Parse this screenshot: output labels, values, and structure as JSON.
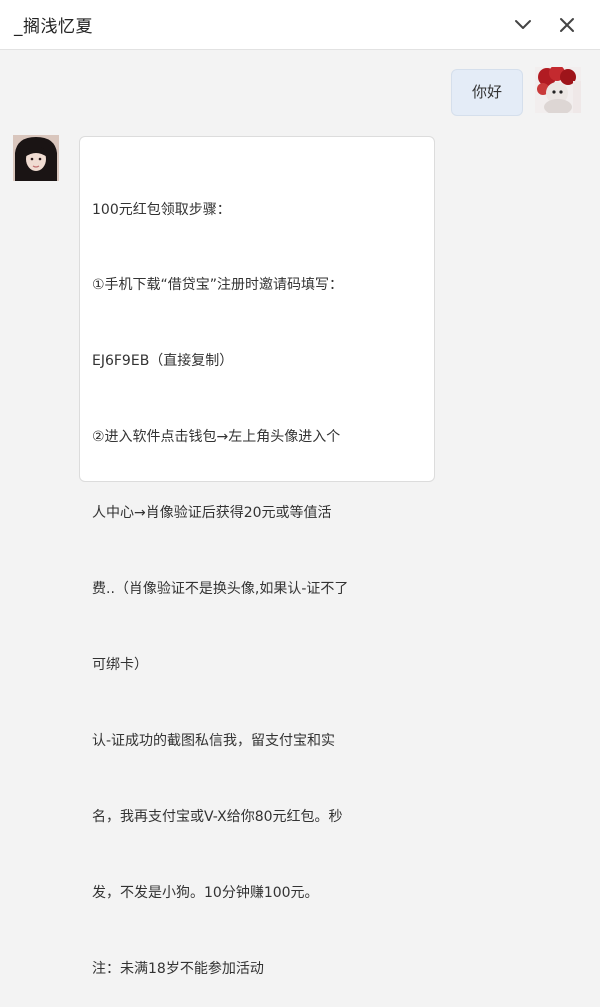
{
  "header": {
    "title": "_搁浅忆夏",
    "minimize_icon": "chevron-down-icon",
    "close_icon": "close-icon"
  },
  "messages": [
    {
      "side": "right",
      "avatar_icon": "avatar-self",
      "text": "你好"
    },
    {
      "side": "left",
      "avatar_icon": "avatar-other",
      "lines": [
        "100元红包领取步骤：",
        "①手机下载“借贷宝”注册时邀请码填写：",
        "EJ6F9EB（直接复制）",
        "②进入软件点击钱包→左上角头像进入个",
        "人中心→肖像验证后获得20元或等值活",
        "费..（肖像验证不是换头像,如果认-证不了",
        "可绑卡）",
        "认-证成功的截图私信我，留支付宝和实",
        "名，我再支付宝或V-X给你80元红包。秒",
        "发，不发是小狗。10分钟赚100元。",
        "注：未满18岁不能参加活动"
      ]
    }
  ],
  "colors": {
    "self_bubble": "#e4ecf7",
    "other_bubble": "#ffffff",
    "background": "#f3f3f3"
  }
}
